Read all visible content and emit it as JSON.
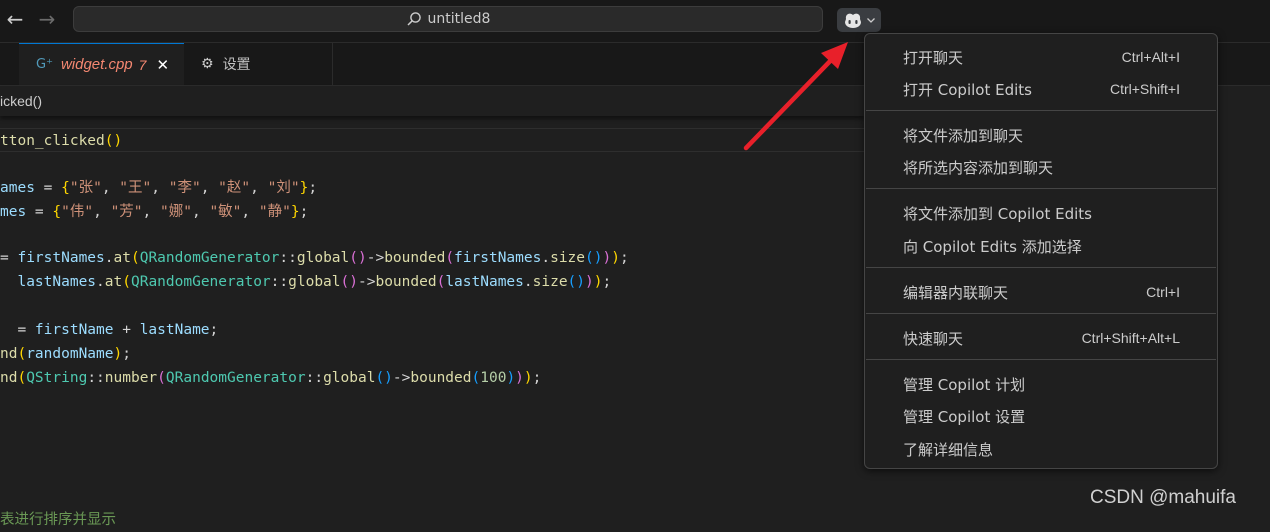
{
  "titlebar": {
    "back_icon": "arrow-left",
    "forward_icon": "arrow-right",
    "search_text": "untitled8",
    "copilot_icon": "copilot-icon"
  },
  "tabs": [
    {
      "icon": "G",
      "label": "widget.cpp",
      "badge": "7",
      "close": "✕"
    },
    {
      "icon": "⚙",
      "label": "设置"
    }
  ],
  "breadcrumb": "icked()",
  "code_lines": [
    [
      [
        "fn",
        "tton_clicked"
      ],
      [
        "p1",
        "()"
      ]
    ],
    [],
    [
      [
        "var",
        "ames"
      ],
      [
        "op",
        " = "
      ],
      [
        "p1",
        "{"
      ],
      [
        "str",
        "\"张\""
      ],
      [
        "op",
        ", "
      ],
      [
        "str",
        "\"王\""
      ],
      [
        "op",
        ", "
      ],
      [
        "str",
        "\"李\""
      ],
      [
        "op",
        ", "
      ],
      [
        "str",
        "\"赵\""
      ],
      [
        "op",
        ", "
      ],
      [
        "str",
        "\"刘\""
      ],
      [
        "p1",
        "}"
      ],
      [
        "op",
        ";"
      ]
    ],
    [
      [
        "var",
        "mes"
      ],
      [
        "op",
        " = "
      ],
      [
        "p1",
        "{"
      ],
      [
        "str",
        "\"伟\""
      ],
      [
        "op",
        ", "
      ],
      [
        "str",
        "\"芳\""
      ],
      [
        "op",
        ", "
      ],
      [
        "str",
        "\"娜\""
      ],
      [
        "op",
        ", "
      ],
      [
        "str",
        "\"敏\""
      ],
      [
        "op",
        ", "
      ],
      [
        "str",
        "\"静\""
      ],
      [
        "p1",
        "}"
      ],
      [
        "op",
        ";"
      ]
    ],
    [],
    [
      [
        "op",
        "= "
      ],
      [
        "var",
        "firstNames"
      ],
      [
        "op",
        "."
      ],
      [
        "fn",
        "at"
      ],
      [
        "p1",
        "("
      ],
      [
        "typ",
        "QRandomGenerator"
      ],
      [
        "op",
        "::"
      ],
      [
        "fn",
        "global"
      ],
      [
        "p2",
        "()"
      ],
      [
        "op",
        "->"
      ],
      [
        "fn",
        "bounded"
      ],
      [
        "p2",
        "("
      ],
      [
        "var",
        "firstNames"
      ],
      [
        "op",
        "."
      ],
      [
        "fn",
        "size"
      ],
      [
        "p3",
        "()"
      ],
      [
        "p2",
        ")"
      ],
      [
        "p1",
        ")"
      ],
      [
        "op",
        ";"
      ]
    ],
    [
      [
        "op",
        "  "
      ],
      [
        "var",
        "lastNames"
      ],
      [
        "op",
        "."
      ],
      [
        "fn",
        "at"
      ],
      [
        "p1",
        "("
      ],
      [
        "typ",
        "QRandomGenerator"
      ],
      [
        "op",
        "::"
      ],
      [
        "fn",
        "global"
      ],
      [
        "p2",
        "()"
      ],
      [
        "op",
        "->"
      ],
      [
        "fn",
        "bounded"
      ],
      [
        "p2",
        "("
      ],
      [
        "var",
        "lastNames"
      ],
      [
        "op",
        "."
      ],
      [
        "fn",
        "size"
      ],
      [
        "p3",
        "()"
      ],
      [
        "p2",
        ")"
      ],
      [
        "p1",
        ")"
      ],
      [
        "op",
        ";"
      ]
    ],
    [],
    [
      [
        "op",
        "  = "
      ],
      [
        "var",
        "firstName"
      ],
      [
        "op",
        " + "
      ],
      [
        "var",
        "lastName"
      ],
      [
        "op",
        ";"
      ]
    ],
    [
      [
        "fn",
        "nd"
      ],
      [
        "p1",
        "("
      ],
      [
        "var",
        "randomName"
      ],
      [
        "p1",
        ")"
      ],
      [
        "op",
        ";"
      ]
    ],
    [
      [
        "fn",
        "nd"
      ],
      [
        "p1",
        "("
      ],
      [
        "typ",
        "QString"
      ],
      [
        "op",
        "::"
      ],
      [
        "fn",
        "number"
      ],
      [
        "p2",
        "("
      ],
      [
        "typ",
        "QRandomGenerator"
      ],
      [
        "op",
        "::"
      ],
      [
        "fn",
        "global"
      ],
      [
        "p3",
        "()"
      ],
      [
        "op",
        "->"
      ],
      [
        "fn",
        "bounded"
      ],
      [
        "p3",
        "("
      ],
      [
        "num",
        "100"
      ],
      [
        "p3",
        ")"
      ],
      [
        "p2",
        ")"
      ],
      [
        "p1",
        ")"
      ],
      [
        "op",
        ";"
      ]
    ],
    [],
    [],
    [],
    [],
    [],
    [
      [
        "cmt",
        "表进行排序并显示"
      ]
    ]
  ],
  "menu": {
    "items": [
      {
        "label": "打开聊天",
        "shortcut": "Ctrl+Alt+I"
      },
      {
        "label": "打开 Copilot Edits",
        "shortcut": "Ctrl+Shift+I"
      },
      {
        "label": "将文件添加到聊天",
        "shortcut": ""
      },
      {
        "label": "将所选内容添加到聊天",
        "shortcut": ""
      },
      {
        "label": "将文件添加到 Copilot Edits",
        "shortcut": ""
      },
      {
        "label": "向 Copilot Edits 添加选择",
        "shortcut": ""
      },
      {
        "label": "编辑器内联聊天",
        "shortcut": "Ctrl+I"
      },
      {
        "label": "快速聊天",
        "shortcut": "Ctrl+Shift+Alt+L"
      },
      {
        "label": "管理 Copilot 计划",
        "shortcut": ""
      },
      {
        "label": "管理 Copilot 设置",
        "shortcut": ""
      },
      {
        "label": "了解详细信息",
        "shortcut": ""
      }
    ]
  },
  "watermark": "CSDN @mahuifa",
  "colors": {
    "accent": "#0078d4",
    "arrow": "#e8202a",
    "tab_modified": "#f48771"
  }
}
